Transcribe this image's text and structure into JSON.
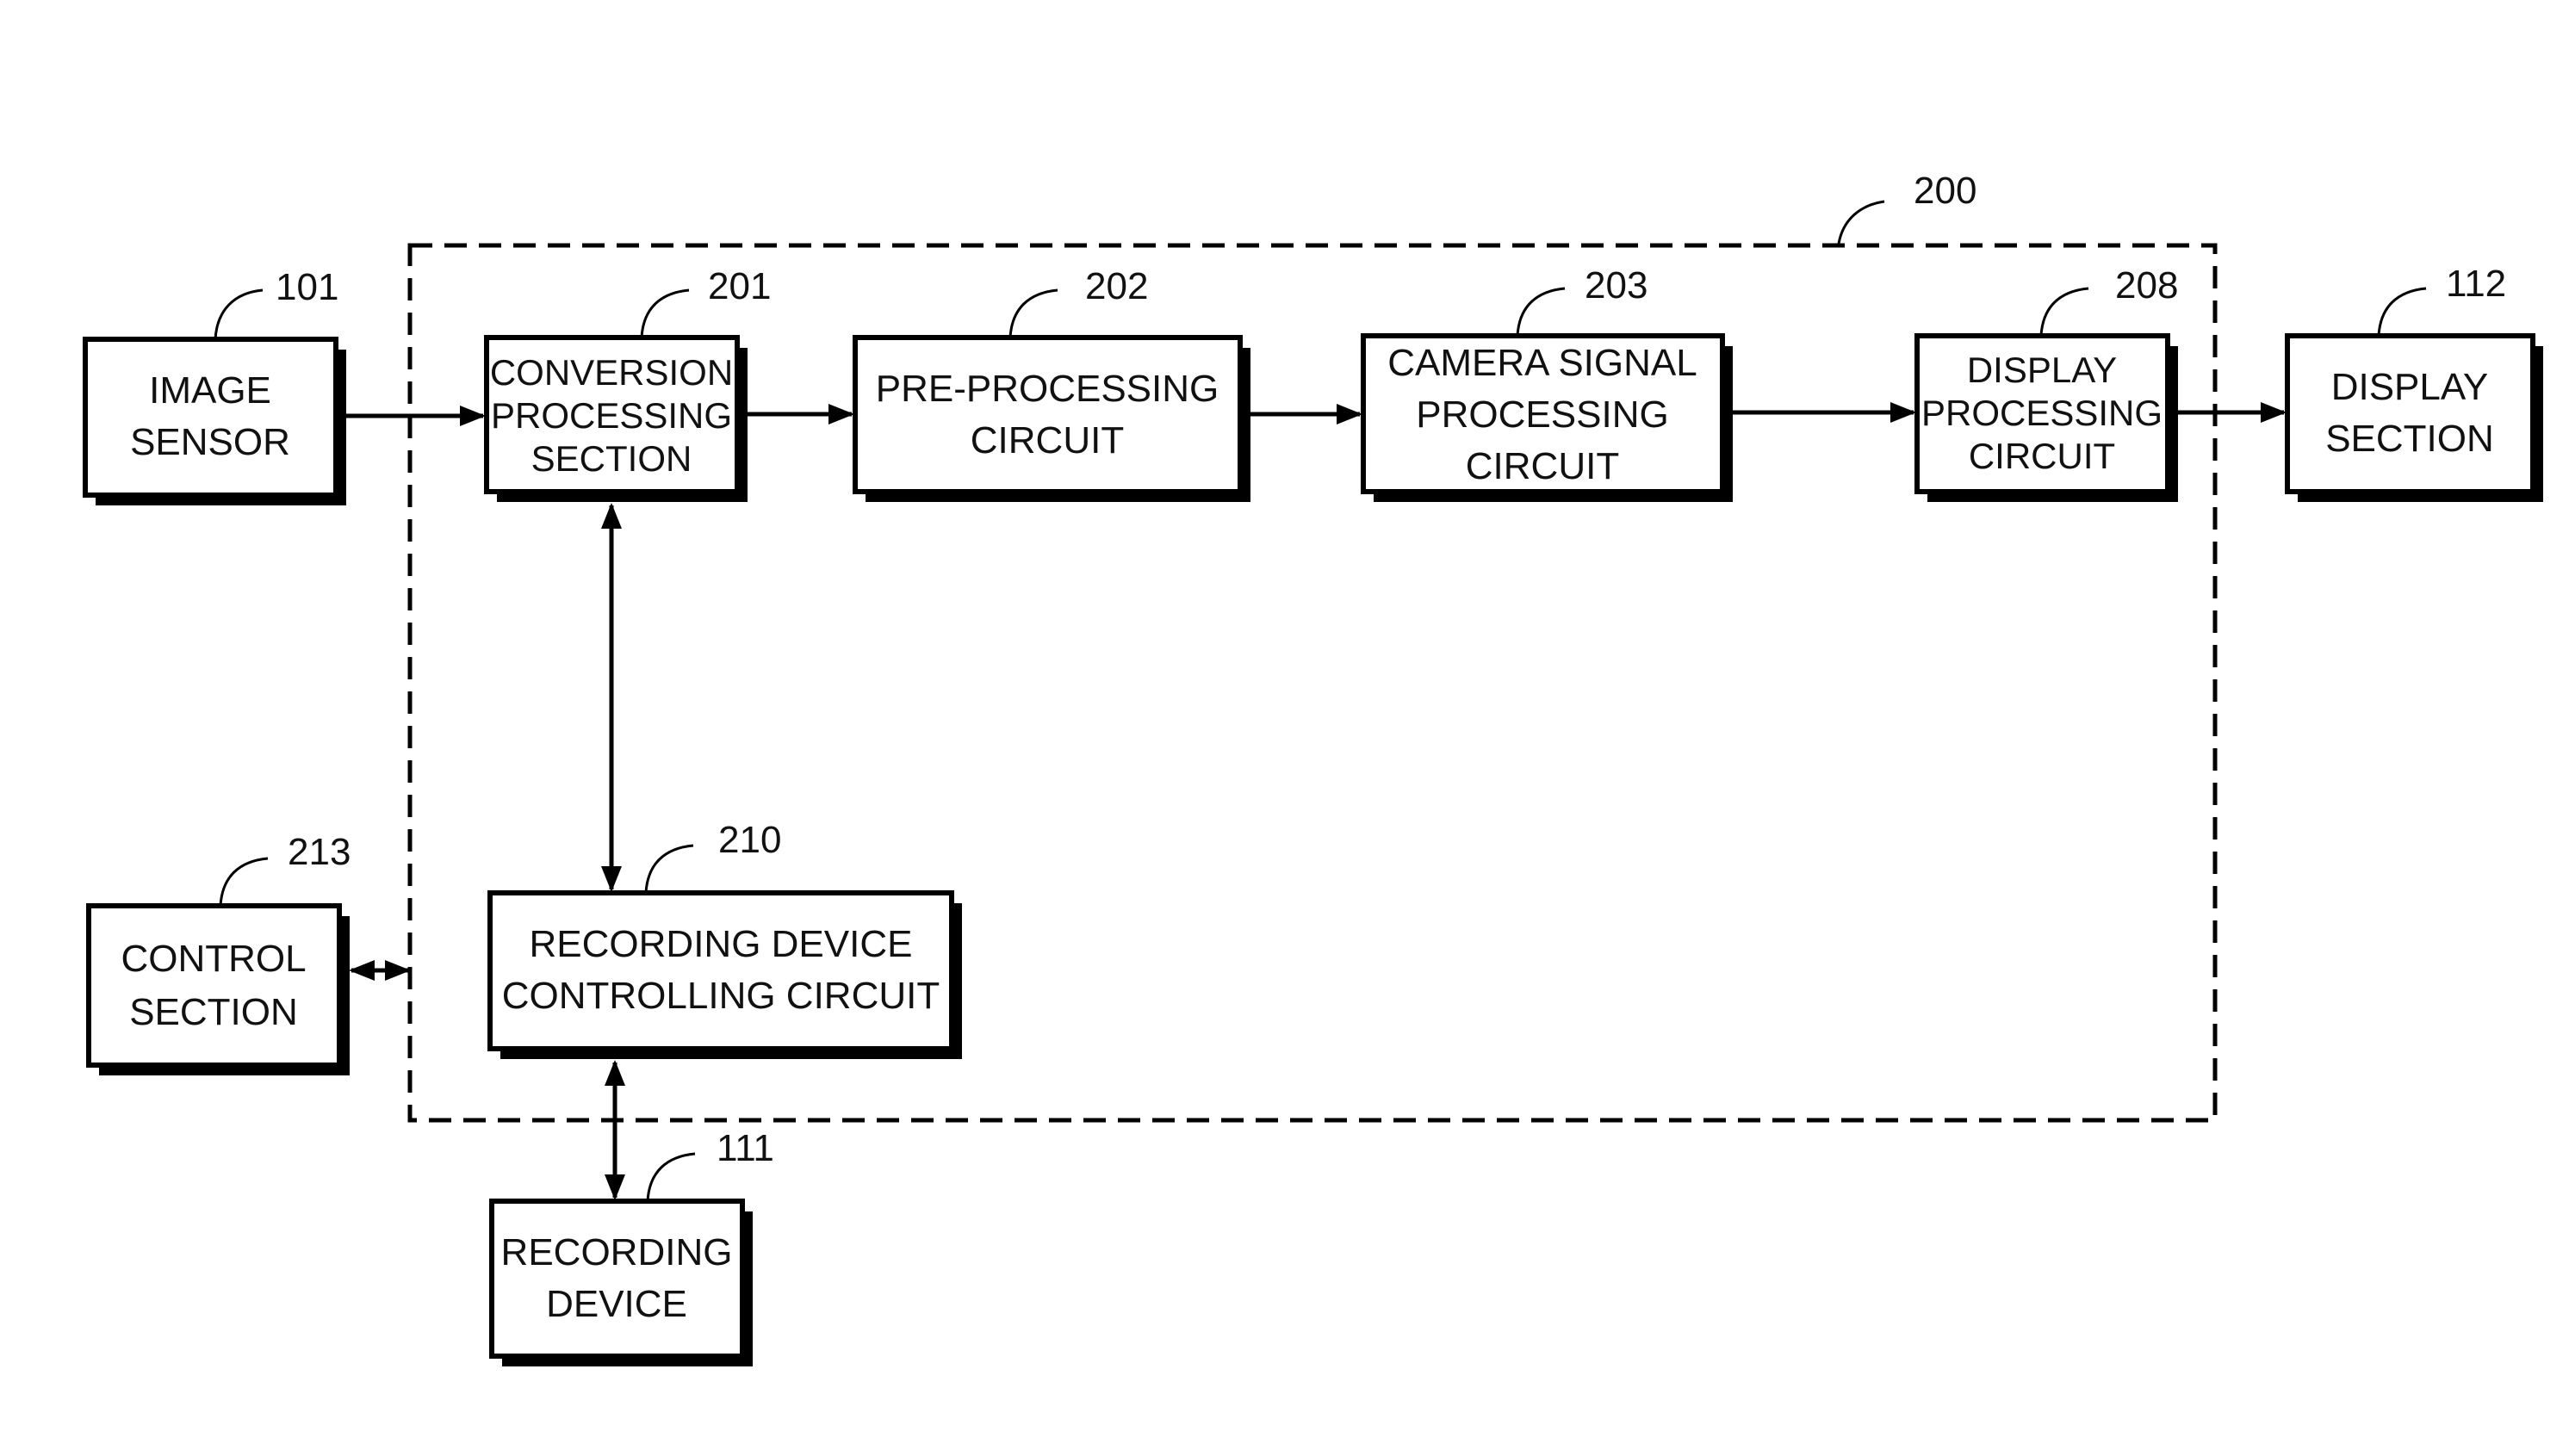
{
  "diagram": {
    "title": "",
    "group": {
      "ref": "200"
    },
    "blocks": [
      {
        "id": "image_sensor",
        "ref": "101",
        "lines": [
          "IMAGE",
          "SENSOR"
        ]
      },
      {
        "id": "conversion",
        "ref": "201",
        "lines": [
          "CONVERSION",
          "PROCESSING",
          "SECTION"
        ]
      },
      {
        "id": "pre_processing",
        "ref": "202",
        "lines": [
          "PRE-PROCESSING",
          "CIRCUIT"
        ]
      },
      {
        "id": "camera_signal",
        "ref": "203",
        "lines": [
          "CAMERA SIGNAL",
          "PROCESSING",
          "CIRCUIT"
        ]
      },
      {
        "id": "display_processing",
        "ref": "208",
        "lines": [
          "DISPLAY",
          "PROCESSING",
          "CIRCUIT"
        ]
      },
      {
        "id": "display_section",
        "ref": "112",
        "lines": [
          "DISPLAY",
          "SECTION"
        ]
      },
      {
        "id": "recording_controller",
        "ref": "210",
        "lines": [
          "RECORDING DEVICE",
          "CONTROLLING CIRCUIT"
        ]
      },
      {
        "id": "control_section",
        "ref": "213",
        "lines": [
          "CONTROL",
          "SECTION"
        ]
      },
      {
        "id": "recording_device",
        "ref": "111",
        "lines": [
          "RECORDING",
          "DEVICE"
        ]
      }
    ],
    "connections": [
      {
        "from": "image_sensor",
        "to": "conversion",
        "direction": "one-way"
      },
      {
        "from": "conversion",
        "to": "pre_processing",
        "direction": "one-way"
      },
      {
        "from": "pre_processing",
        "to": "camera_signal",
        "direction": "one-way"
      },
      {
        "from": "camera_signal",
        "to": "display_processing",
        "direction": "one-way"
      },
      {
        "from": "display_processing",
        "to": "display_section",
        "direction": "one-way"
      },
      {
        "from": "conversion",
        "to": "recording_controller",
        "direction": "two-way"
      },
      {
        "from": "recording_controller",
        "to": "recording_device",
        "direction": "two-way"
      },
      {
        "from": "control_section",
        "to": "group_200",
        "direction": "two-way"
      }
    ]
  }
}
